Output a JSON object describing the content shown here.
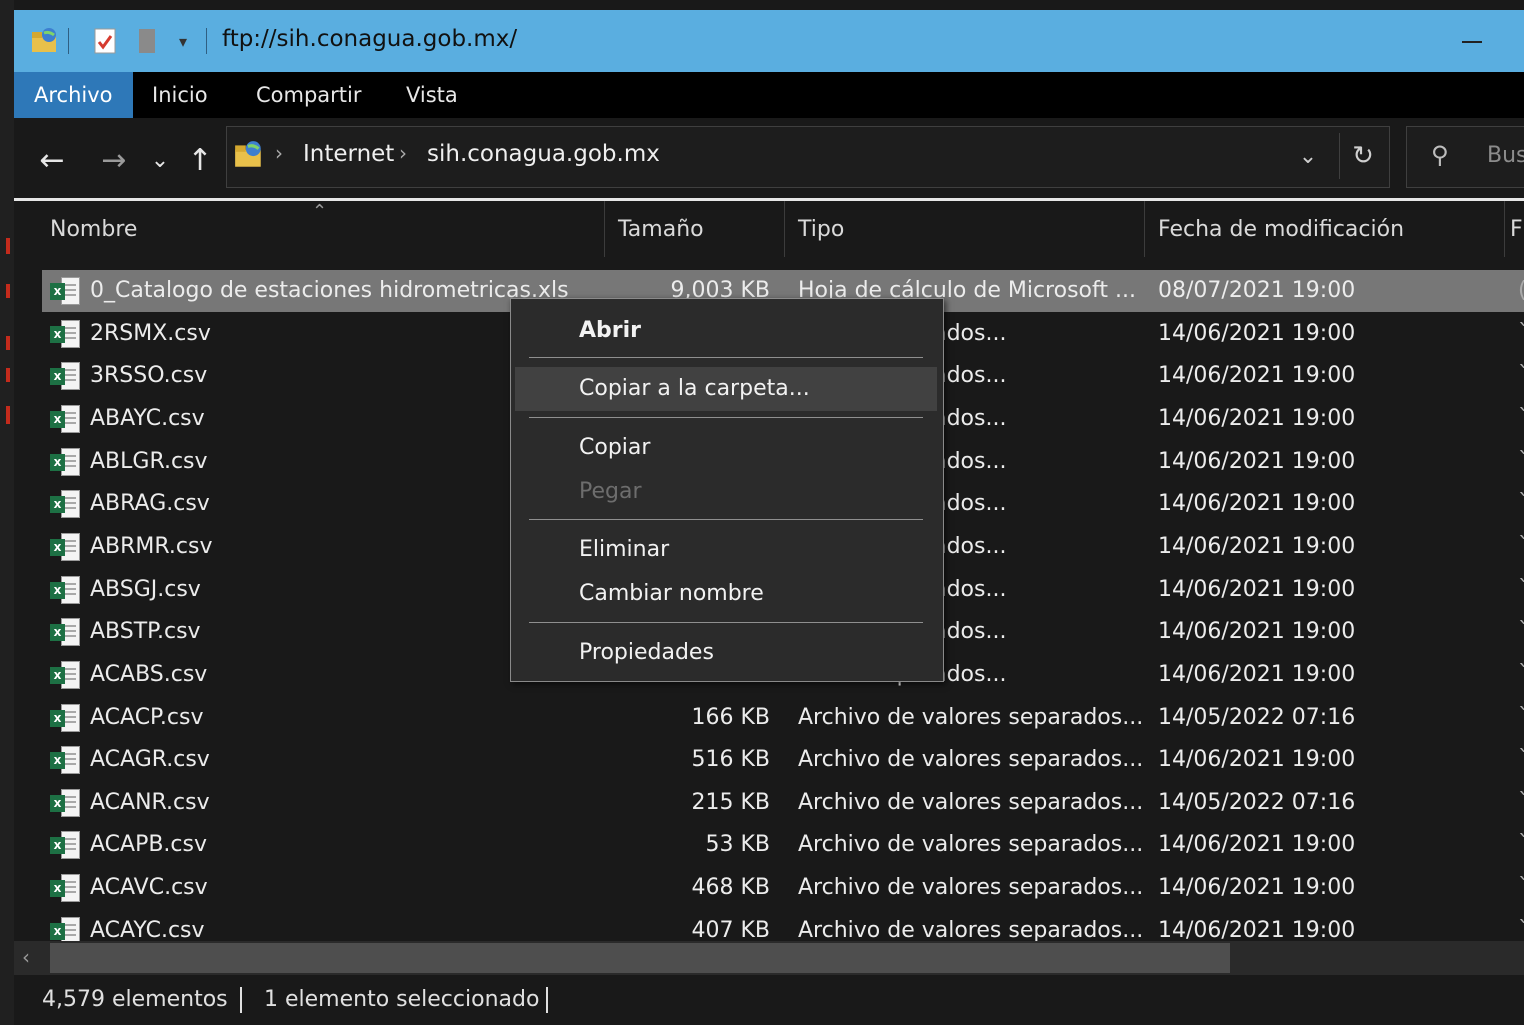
{
  "window": {
    "title": "ftp://sih.conagua.gob.mx/"
  },
  "ribbon": {
    "tabs": [
      "Archivo",
      "Inicio",
      "Compartir",
      "Vista"
    ]
  },
  "nav": {
    "breadcrumb": [
      "Internet",
      "sih.conagua.gob.mx"
    ],
    "search_placeholder": "Bus"
  },
  "columns": {
    "name": "Nombre",
    "size": "Tamaño",
    "type": "Tipo",
    "date": "Fecha de modificación",
    "extra": "F"
  },
  "files": [
    {
      "name": "0_Catalogo de estaciones hidrometricas.xls",
      "size": "9,003 KB",
      "type": "Hoja de cálculo de Microsoft ...",
      "date": "08/07/2021 19:00",
      "icon": "excel-xls-icon",
      "trail": "("
    },
    {
      "name": "2RSMX.csv",
      "size": "",
      "type": "alores separados...",
      "date": "14/06/2021 19:00",
      "icon": "excel-csv-icon",
      "trail": "`"
    },
    {
      "name": "3RSSO.csv",
      "size": "",
      "type": "alores separados...",
      "date": "14/06/2021 19:00",
      "icon": "excel-csv-icon",
      "trail": "`"
    },
    {
      "name": "ABAYC.csv",
      "size": "",
      "type": "alores separados...",
      "date": "14/06/2021 19:00",
      "icon": "excel-csv-icon",
      "trail": "`"
    },
    {
      "name": "ABLGR.csv",
      "size": "",
      "type": "alores separados...",
      "date": "14/06/2021 19:00",
      "icon": "excel-csv-icon",
      "trail": "`"
    },
    {
      "name": "ABRAG.csv",
      "size": "",
      "type": "alores separados...",
      "date": "14/06/2021 19:00",
      "icon": "excel-csv-icon",
      "trail": "`"
    },
    {
      "name": "ABRMR.csv",
      "size": "",
      "type": "alores separados...",
      "date": "14/06/2021 19:00",
      "icon": "excel-csv-icon",
      "trail": "`"
    },
    {
      "name": "ABSGJ.csv",
      "size": "",
      "type": "alores separados...",
      "date": "14/06/2021 19:00",
      "icon": "excel-csv-icon",
      "trail": "`"
    },
    {
      "name": "ABSTP.csv",
      "size": "",
      "type": "alores separados...",
      "date": "14/06/2021 19:00",
      "icon": "excel-csv-icon",
      "trail": "`"
    },
    {
      "name": "ACABS.csv",
      "size": "",
      "type": "alores separados...",
      "date": "14/06/2021 19:00",
      "icon": "excel-csv-icon",
      "trail": "`"
    },
    {
      "name": "ACACP.csv",
      "size": "166 KB",
      "type": "Archivo de valores separados...",
      "date": "14/05/2022 07:16",
      "icon": "excel-csv-icon",
      "trail": "`"
    },
    {
      "name": "ACAGR.csv",
      "size": "516 KB",
      "type": "Archivo de valores separados...",
      "date": "14/06/2021 19:00",
      "icon": "excel-csv-icon",
      "trail": "`"
    },
    {
      "name": "ACANR.csv",
      "size": "215 KB",
      "type": "Archivo de valores separados...",
      "date": "14/05/2022 07:16",
      "icon": "excel-csv-icon",
      "trail": "`"
    },
    {
      "name": "ACAPB.csv",
      "size": "53 KB",
      "type": "Archivo de valores separados...",
      "date": "14/06/2021 19:00",
      "icon": "excel-csv-icon",
      "trail": "`"
    },
    {
      "name": "ACAVC.csv",
      "size": "468 KB",
      "type": "Archivo de valores separados...",
      "date": "14/06/2021 19:00",
      "icon": "excel-csv-icon",
      "trail": "`"
    },
    {
      "name": "ACAYC.csv",
      "size": "407 KB",
      "type": "Archivo de valores separados...",
      "date": "14/06/2021 19:00",
      "icon": "excel-csv-icon",
      "trail": "`"
    }
  ],
  "context_menu": {
    "open": "Abrir",
    "copy_to": "Copiar a la carpeta...",
    "copy": "Copiar",
    "paste": "Pegar",
    "delete": "Eliminar",
    "rename": "Cambiar nombre",
    "properties": "Propiedades"
  },
  "status": {
    "count": "4,579 elementos",
    "selected": "1 elemento seleccionado"
  },
  "colors": {
    "titlebar": "#5aaee0",
    "active_tab": "#2e78b8",
    "background": "#191919",
    "selected_row": "#777777",
    "excel_green": "#1d7044"
  }
}
